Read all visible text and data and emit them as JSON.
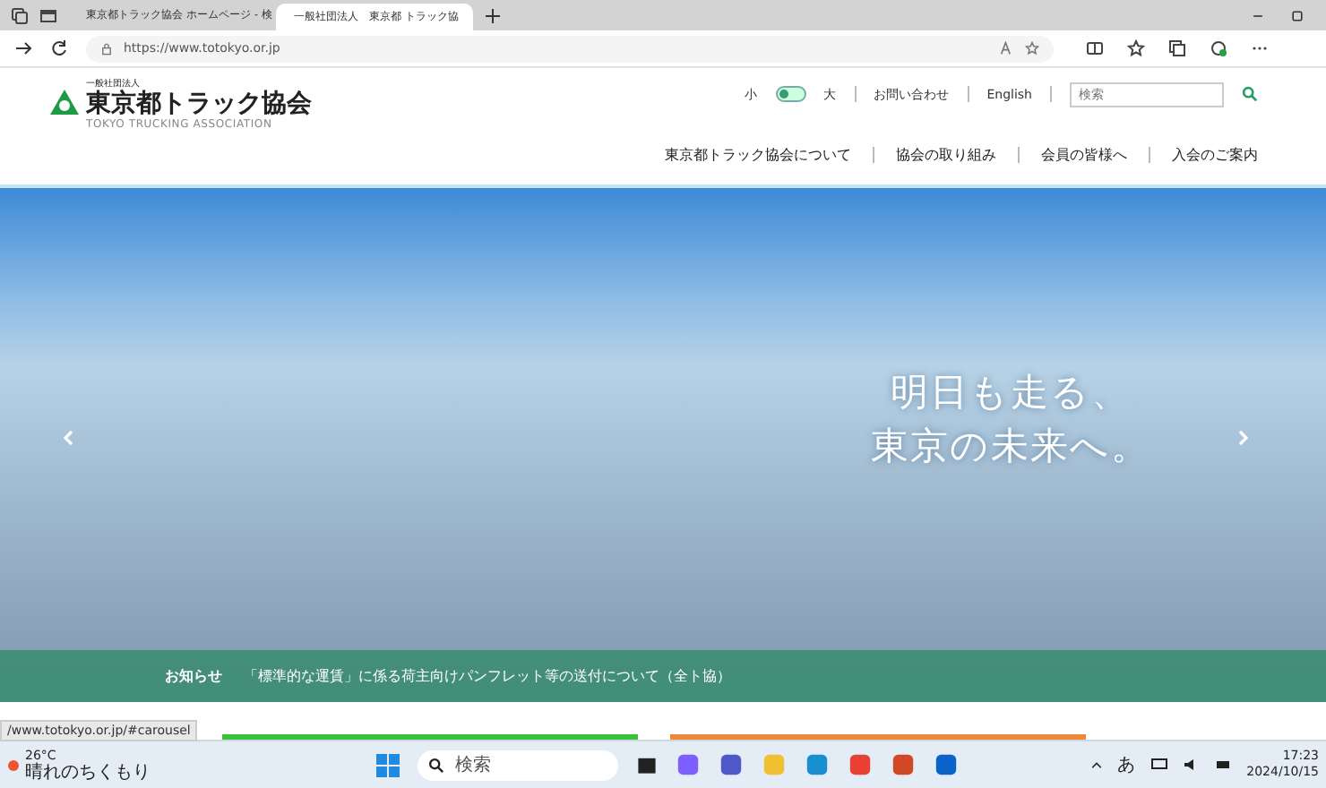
{
  "browser": {
    "tabs": [
      {
        "title": "東京都トラック協会 ホームページ - 検",
        "selected": false
      },
      {
        "title": "一般社団法人　東京都 トラック協",
        "selected": true
      }
    ],
    "address": "https://www.totokyo.or.jp"
  },
  "site": {
    "logo": {
      "org_type": "一般社団法人",
      "name": "東京都トラック協会",
      "tagline": "TOKYO TRUCKING ASSOCIATION"
    },
    "utility": {
      "size_small": "小",
      "size_large": "大",
      "size_toggle_on": false,
      "links": [
        "お問い合わせ",
        "English"
      ],
      "search_placeholder": "検索"
    },
    "nav": [
      "東京都トラック協会について",
      "協会の取り組み",
      "会員の皆様へ",
      "入会のご案内"
    ],
    "hero": {
      "headline": [
        "明日も走る、",
        "東京の未来へ。"
      ],
      "news_label": "お知らせ",
      "news_text": "「標準的な運賃」に係る荷主向けパンフレット等の送付について（全ト協）"
    }
  },
  "status_url": "/www.totokyo.or.jp/#carousel",
  "taskbar": {
    "temperature": "26°C",
    "weather": "晴れのちくもり",
    "search_placeholder": "検索",
    "ime": "あ",
    "time": "17:23",
    "date": "2024/10/15"
  }
}
